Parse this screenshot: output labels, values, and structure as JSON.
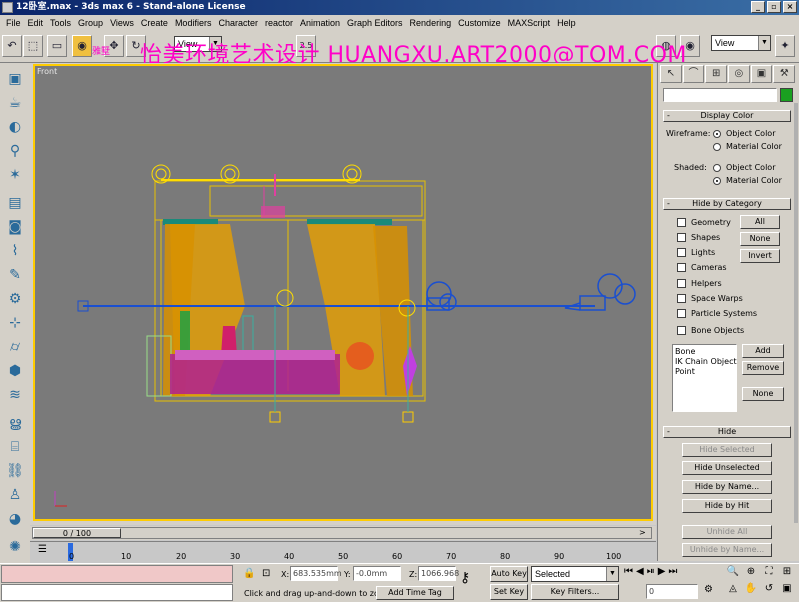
{
  "window": {
    "title": "12卧室.max - 3ds max 6 - Stand-alone License",
    "min": "_",
    "max": "▫",
    "close": "×"
  },
  "menu": [
    "File",
    "Edit",
    "Tools",
    "Group",
    "Views",
    "Create",
    "Modifiers",
    "Character",
    "reactor",
    "Animation",
    "Graph Editors",
    "Rendering",
    "Customize",
    "MAXScript",
    "Help"
  ],
  "toolbar": {
    "view_dropdown": "View",
    "view_dropdown2": "View",
    "coord_value": "2.5"
  },
  "watermark": {
    "text": "怡美环境艺术设计  HUANGXU.ART2000@TOM.COM",
    "small": "雅墅"
  },
  "viewport": {
    "label": "Front"
  },
  "command_panel": {
    "display_color": {
      "title": "Display Color",
      "wireframe_label": "Wireframe:",
      "shaded_label": "Shaded:",
      "object_color": "Object Color",
      "material_color": "Material Color"
    },
    "hide_by_category": {
      "title": "Hide by Category",
      "items": [
        "Geometry",
        "Shapes",
        "Lights",
        "Cameras",
        "Helpers",
        "Space Warps",
        "Particle Systems",
        "Bone Objects"
      ],
      "all": "All",
      "none": "None",
      "invert": "Invert",
      "list_items": [
        "Bone",
        "IK Chain Object",
        "Point"
      ],
      "add": "Add",
      "remove": "Remove",
      "none2": "None"
    },
    "hide": {
      "title": "Hide",
      "hide_selected": "Hide Selected",
      "hide_unselected": "Hide Unselected",
      "hide_by_name": "Hide by Name...",
      "hide_by_hit": "Hide by Hit",
      "unhide_all": "Unhide All",
      "unhide_by_name": "Unhide by Name..."
    }
  },
  "timeline": {
    "frame": "0 / 100",
    "ticks": [
      "0",
      "10",
      "20",
      "30",
      "40",
      "50",
      "60",
      "70",
      "80",
      "90",
      "100"
    ]
  },
  "status": {
    "x_label": "X:",
    "x_value": "683.535mm",
    "y_label": "Y:",
    "y_value": "-0.0mm",
    "z_label": "Z:",
    "z_value": "1066.968",
    "prompt": "Click and drag up-and-down to zoo",
    "add_time_tag": "Add Time Tag",
    "auto_key": "Auto Key",
    "set_key": "Set Key",
    "selected": "Selected",
    "key_filters": "Key Filters...",
    "frame_field": "0"
  },
  "colors": {
    "wire_yellow": "#ffcc00",
    "curtain": "#e8a000",
    "pink": "#e040a0",
    "blue": "#1a4fd0",
    "viewport_bg": "#7a7a7a"
  }
}
